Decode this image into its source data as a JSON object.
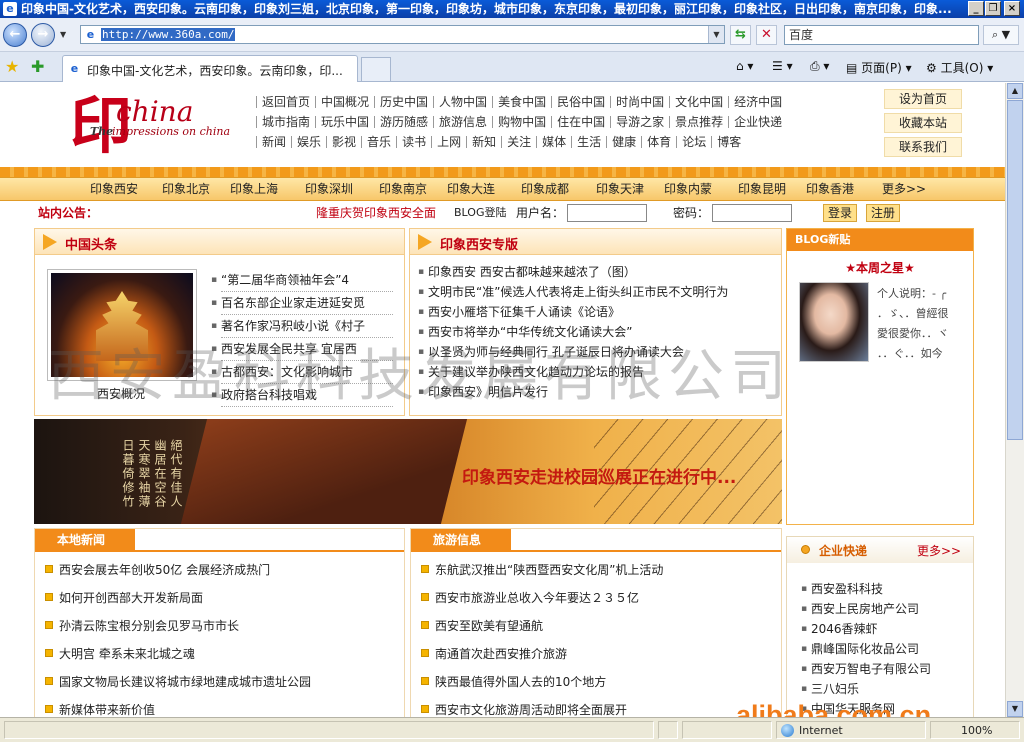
{
  "window": {
    "title": "印象中国-文化艺术，西安印象。云南印象，印象刘三姐，北京印象，第一印象，印象坊，城市印象，东京印象，最初印象，丽江印象，印象社区，日出印象，南京印象，印象..."
  },
  "browser": {
    "url": "http://www.360a.com/",
    "search_placeholder": "百度",
    "tab_title": "印象中国-文化艺术，西安印象。云南印象，印...",
    "commands": {
      "page": "页面(P)",
      "tools": "工具(O)"
    },
    "status_zone": "Internet",
    "zoom": "100%"
  },
  "site": {
    "logo": {
      "glyph": "印",
      "word": "china",
      "the": "The",
      "tagline": "impressions on china"
    },
    "nav_row1": [
      "返回首页",
      "中国概况",
      "历史中国",
      "人物中国",
      "美食中国",
      "民俗中国",
      "时尚中国",
      "文化中国",
      "经济中国"
    ],
    "nav_row2": [
      "城市指南",
      "玩乐中国",
      "游历随感",
      "旅游信息",
      "购物中国",
      "住在中国",
      "导游之家",
      "景点推荐",
      "企业快递"
    ],
    "nav_row3": [
      "新闻",
      "娱乐",
      "影视",
      "音乐",
      "读书",
      "上网",
      "新知",
      "关注",
      "媒体",
      "生活",
      "健康",
      "体育",
      "论坛",
      "博客"
    ],
    "right_links": [
      "设为首页",
      "收藏本站",
      "联系我们"
    ],
    "cities": [
      "印象西安",
      "印象北京",
      "印象上海",
      "印象深圳",
      "印象南京",
      "印象大连",
      "印象成都",
      "印象天津",
      "印象内蒙",
      "印象昆明",
      "印象香港",
      "更多>>"
    ],
    "notice_label": "站内公告：",
    "notice_ticker": "隆重庆贺印象西安全面",
    "blog_login": "BLOG登陆",
    "username_label": "用户名：",
    "password_label": "密码：",
    "login_btn": "登录",
    "register_btn": "注册"
  },
  "headlines": {
    "title": "中国头条",
    "photo_caption": "西安概况",
    "items": [
      "“第二届华商领袖年会”4",
      "百名东部企业家走进延安觅",
      "著名作家冯积岐小说《村子",
      "西安发展全民共享 宜居西",
      "古都西安：文化影响城市",
      "政府搭台科技唱戏"
    ]
  },
  "xian": {
    "title": "印象西安专版",
    "items": [
      "印象西安   西安古都味越来越浓了（图）",
      "文明市民“准”候选人代表将走上街头纠正市民不文明行为",
      "西安小雁塔下征集千人诵读《论语》",
      "西安市将举办“中华传统文化诵读大会”",
      "以圣贤为师与经典同行 孔子诞辰日将办诵读大会",
      "关于建议举办陕西文化趋动力论坛的报告",
      "印象西安》明信片发行"
    ]
  },
  "blog": {
    "title": "BLOG新贴",
    "star": "★本周之星★",
    "intro": [
      "个人说明：- ╭",
      "．ゞ、．曾經很",
      "愛很愛你．．ヾ",
      "．．ぐ．．如今"
    ]
  },
  "banner": {
    "poem": "絕代有佳人 幽居在空谷 天寒翠袖薄 日暮倚修竹",
    "slogan": "印象西安走进校园巡展正在进行中..."
  },
  "local": {
    "title": "本地新闻",
    "items": [
      "西安会展去年创收50亿 会展经济成热门",
      "如何开创西部大开发新局面",
      "孙清云陈宝根分别会见罗马市市长",
      "大明宫 牵系未来北城之魂",
      "国家文物局长建议将城市绿地建成城市遗址公园",
      "新媒体带来新价值"
    ]
  },
  "travel": {
    "title": "旅游信息",
    "items": [
      "东航武汉推出“陕西暨西安文化周”机上活动",
      "西安市旅游业总收入今年要达２３５亿",
      "西安至欧美有望通航",
      "南通首次赴西安推介旅游",
      "陕西最值得外国人去的10个地方",
      "西安市文化旅游周活动即将全面展开"
    ]
  },
  "enterprise": {
    "title": "企业快递",
    "more": "更多>>",
    "items": [
      "西安盈科科技",
      "西安上民房地产公司",
      "2046香辣虾",
      "鼎峰国际化妆品公司",
      "西安万智电子有限公司",
      "三八妇乐",
      "中国华天服务网"
    ]
  },
  "overlays": {
    "watermark": "西安盈科科技发展有限公司",
    "alibaba": "alibaba.com.cn"
  }
}
